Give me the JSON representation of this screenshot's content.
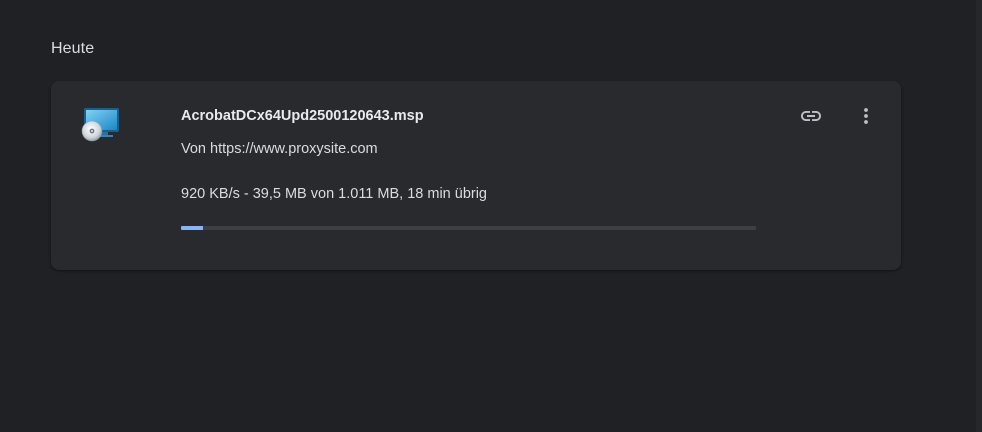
{
  "section": {
    "heading": "Heute"
  },
  "download": {
    "file_name": "AcrobatDCx64Upd2500120643.msp",
    "source": "Von https://www.proxysite.com",
    "status": "920 KB/s - 39,5 MB von 1.011 MB, 18 min übrig",
    "progress_fraction": 0.039,
    "icons": {
      "file": "installer-file-icon",
      "copy_link": "link-icon",
      "more": "more-vert-icon"
    }
  },
  "colors": {
    "background": "#202124",
    "card": "#292a2d",
    "progress_fill": "#8ab4f8",
    "progress_track": "#3c4043"
  }
}
